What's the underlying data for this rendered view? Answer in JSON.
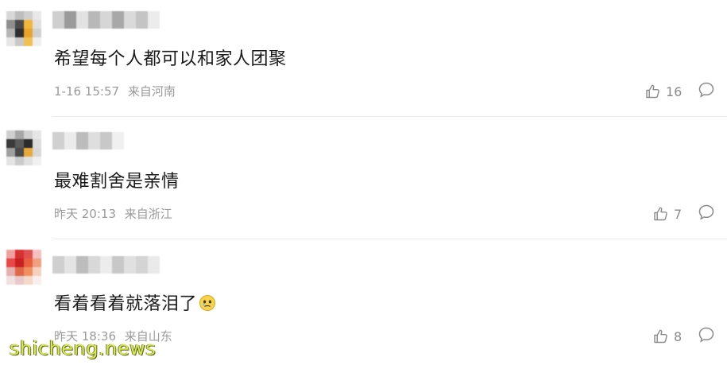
{
  "comments": [
    {
      "text": "希望每个人都可以和家人团聚",
      "date": "1-16 15:57",
      "location": "来自河南",
      "likes": "16",
      "avatar_colors": [
        "#d8d8d8",
        "#bdbdbd",
        "#cfcfcf",
        "#e8e8e8",
        "#8e8e8e",
        "#4a4a4a",
        "#f2b63b",
        "#e0e0e0",
        "#b5b5b5",
        "#2e2e2e",
        "#e8a42a",
        "#d0d0d0",
        "#e6e6e6",
        "#c8c8c8",
        "#f0c050",
        "#efefef"
      ],
      "name_colors": [
        "#cfcfcf",
        "#9a9a9a",
        "#e2e2e2",
        "#b8b8b8",
        "#d6d6d6",
        "#a8a8a8",
        "#dadada",
        "#c4c4c4",
        "#ececec"
      ]
    },
    {
      "text": "最难割舍是亲情",
      "date": "昨天 20:13",
      "location": "来自浙江",
      "likes": "7",
      "avatar_colors": [
        "#cfcfcf",
        "#a6a6a6",
        "#d2d2d2",
        "#e6e6e6",
        "#3a3a3a",
        "#5a5a5a",
        "#2b2b2b",
        "#dcdcdc",
        "#a0a0a0",
        "#4a4a4a",
        "#e8a93a",
        "#d8d8d8",
        "#e4e4e4",
        "#cacaca",
        "#e0e0e0",
        "#f0f0f0"
      ],
      "name_colors": [
        "#d0d0d0",
        "#ececec",
        "#bcbcbc",
        "#dedede",
        "#c8c8c8",
        "#f0f0f0"
      ]
    },
    {
      "text": "看着看着就落泪了",
      "date": "昨天 18:36",
      "location": "来自山东",
      "likes": "8",
      "avatar_colors": [
        "#f0a0a0",
        "#d83030",
        "#e05050",
        "#f4c0c0",
        "#e84848",
        "#c82020",
        "#e86040",
        "#f0a080",
        "#e4b0b0",
        "#e06848",
        "#f09060",
        "#f4d0c0",
        "#f0e0e0",
        "#e8c8c8",
        "#f4d8c8",
        "#fbeeee"
      ],
      "name_colors": [
        "#cfcfcf",
        "#e4e4e4",
        "#bdbdbd",
        "#d8d8d8",
        "#ececec",
        "#c8c8c8",
        "#e0e0e0",
        "#d4d4d4",
        "#eaeaea"
      ]
    }
  ],
  "icons": {
    "like": "thumbs-up-icon",
    "reply": "comment-bubble-icon",
    "emoji": "crying-face-icon"
  },
  "watermark": "shicheng.news"
}
